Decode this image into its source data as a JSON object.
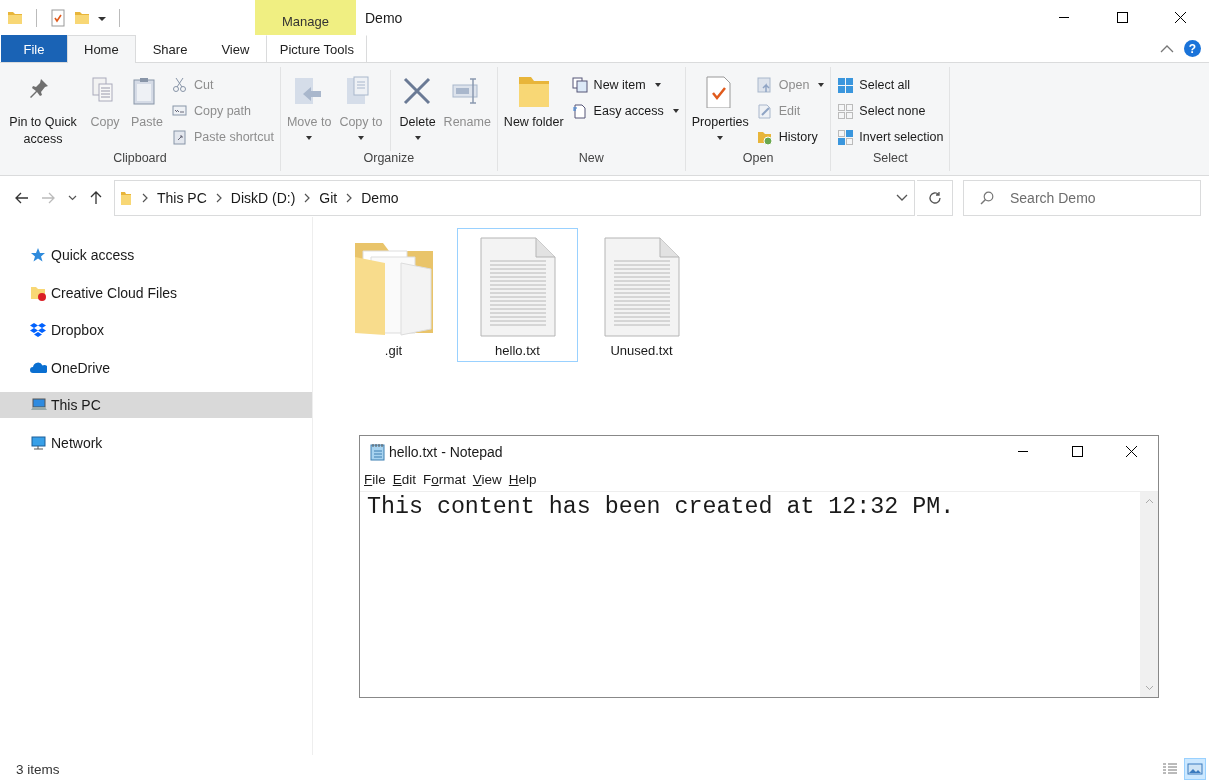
{
  "window": {
    "title": "Demo",
    "context_tab": "Manage"
  },
  "tabs": [
    {
      "label": "File",
      "kind": "file",
      "selected": false
    },
    {
      "label": "Home",
      "kind": "normal",
      "selected": true
    },
    {
      "label": "Share",
      "kind": "normal",
      "selected": false
    },
    {
      "label": "View",
      "kind": "normal",
      "selected": false
    },
    {
      "label": "Picture Tools",
      "kind": "context",
      "selected": false
    }
  ],
  "help": {
    "label": "?"
  },
  "ribbon": {
    "groups": [
      {
        "label": "Clipboard",
        "items": [
          {
            "kind": "large",
            "label": "Pin to Quick access",
            "disabled": false,
            "dropdown": false
          },
          {
            "kind": "large",
            "label": "Copy",
            "disabled": true,
            "dropdown": false
          },
          {
            "kind": "large",
            "label": "Paste",
            "disabled": true,
            "dropdown": false
          },
          {
            "kind": "small",
            "label": "Cut",
            "disabled": true,
            "dropdown": false
          },
          {
            "kind": "small",
            "label": "Copy path",
            "disabled": true,
            "dropdown": false
          },
          {
            "kind": "small",
            "label": "Paste shortcut",
            "disabled": true,
            "dropdown": false
          }
        ]
      },
      {
        "label": "Organize",
        "items": [
          {
            "kind": "large",
            "label": "Move to",
            "disabled": true,
            "dropdown": true
          },
          {
            "kind": "large",
            "label": "Copy to",
            "disabled": true,
            "dropdown": true
          },
          {
            "kind": "separator"
          },
          {
            "kind": "large",
            "label": "Delete",
            "disabled": false,
            "dropdown": true
          },
          {
            "kind": "large",
            "label": "Rename",
            "disabled": true,
            "dropdown": false
          }
        ]
      },
      {
        "label": "New",
        "items": [
          {
            "kind": "large",
            "label": "New folder",
            "disabled": false,
            "dropdown": false
          },
          {
            "kind": "small",
            "label": "New item",
            "disabled": false,
            "dropdown": true
          },
          {
            "kind": "small",
            "label": "Easy access",
            "disabled": false,
            "dropdown": true
          }
        ]
      },
      {
        "label": "Open",
        "items": [
          {
            "kind": "large",
            "label": "Properties",
            "disabled": false,
            "dropdown": true
          },
          {
            "kind": "small",
            "label": "Open",
            "disabled": true,
            "dropdown": true
          },
          {
            "kind": "small",
            "label": "Edit",
            "disabled": true,
            "dropdown": false
          },
          {
            "kind": "small",
            "label": "History",
            "disabled": false,
            "dropdown": false
          }
        ]
      },
      {
        "label": "Select",
        "items": [
          {
            "kind": "small",
            "label": "Select all",
            "disabled": false,
            "dropdown": false
          },
          {
            "kind": "small",
            "label": "Select none",
            "disabled": false,
            "dropdown": false
          },
          {
            "kind": "small",
            "label": "Invert selection",
            "disabled": false,
            "dropdown": false
          }
        ]
      }
    ]
  },
  "nav": {
    "back_disabled": false,
    "forward_disabled": true
  },
  "breadcrumb": [
    "This PC",
    "DiskD (D:)",
    "Git",
    "Demo"
  ],
  "search": {
    "placeholder": "Search Demo"
  },
  "sidebar": {
    "items": [
      {
        "label": "Quick access",
        "selected": false
      },
      {
        "label": "Creative Cloud Files",
        "selected": false
      },
      {
        "label": "Dropbox",
        "selected": false
      },
      {
        "label": "OneDrive",
        "selected": false
      },
      {
        "label": "This PC",
        "selected": true
      },
      {
        "label": "Network",
        "selected": false
      }
    ]
  },
  "files": [
    {
      "name": ".git",
      "kind": "folder",
      "selected": false
    },
    {
      "name": "hello.txt",
      "kind": "text",
      "selected": true
    },
    {
      "name": "Unused.txt",
      "kind": "text",
      "selected": false
    }
  ],
  "status_bar": {
    "count": "3 items",
    "views": [
      {
        "kind": "details",
        "selected": false
      },
      {
        "kind": "large-icons",
        "selected": true
      }
    ]
  },
  "notepad": {
    "title": "hello.txt - Notepad",
    "menu": [
      {
        "key": "F",
        "post": "ile"
      },
      {
        "key": "E",
        "post": "dit"
      },
      {
        "pre": "F",
        "key": "o",
        "post": "rmat"
      },
      {
        "key": "V",
        "post": "iew"
      },
      {
        "key": "H",
        "post": "elp"
      }
    ],
    "content": "This content has been created at 12:32 PM."
  }
}
